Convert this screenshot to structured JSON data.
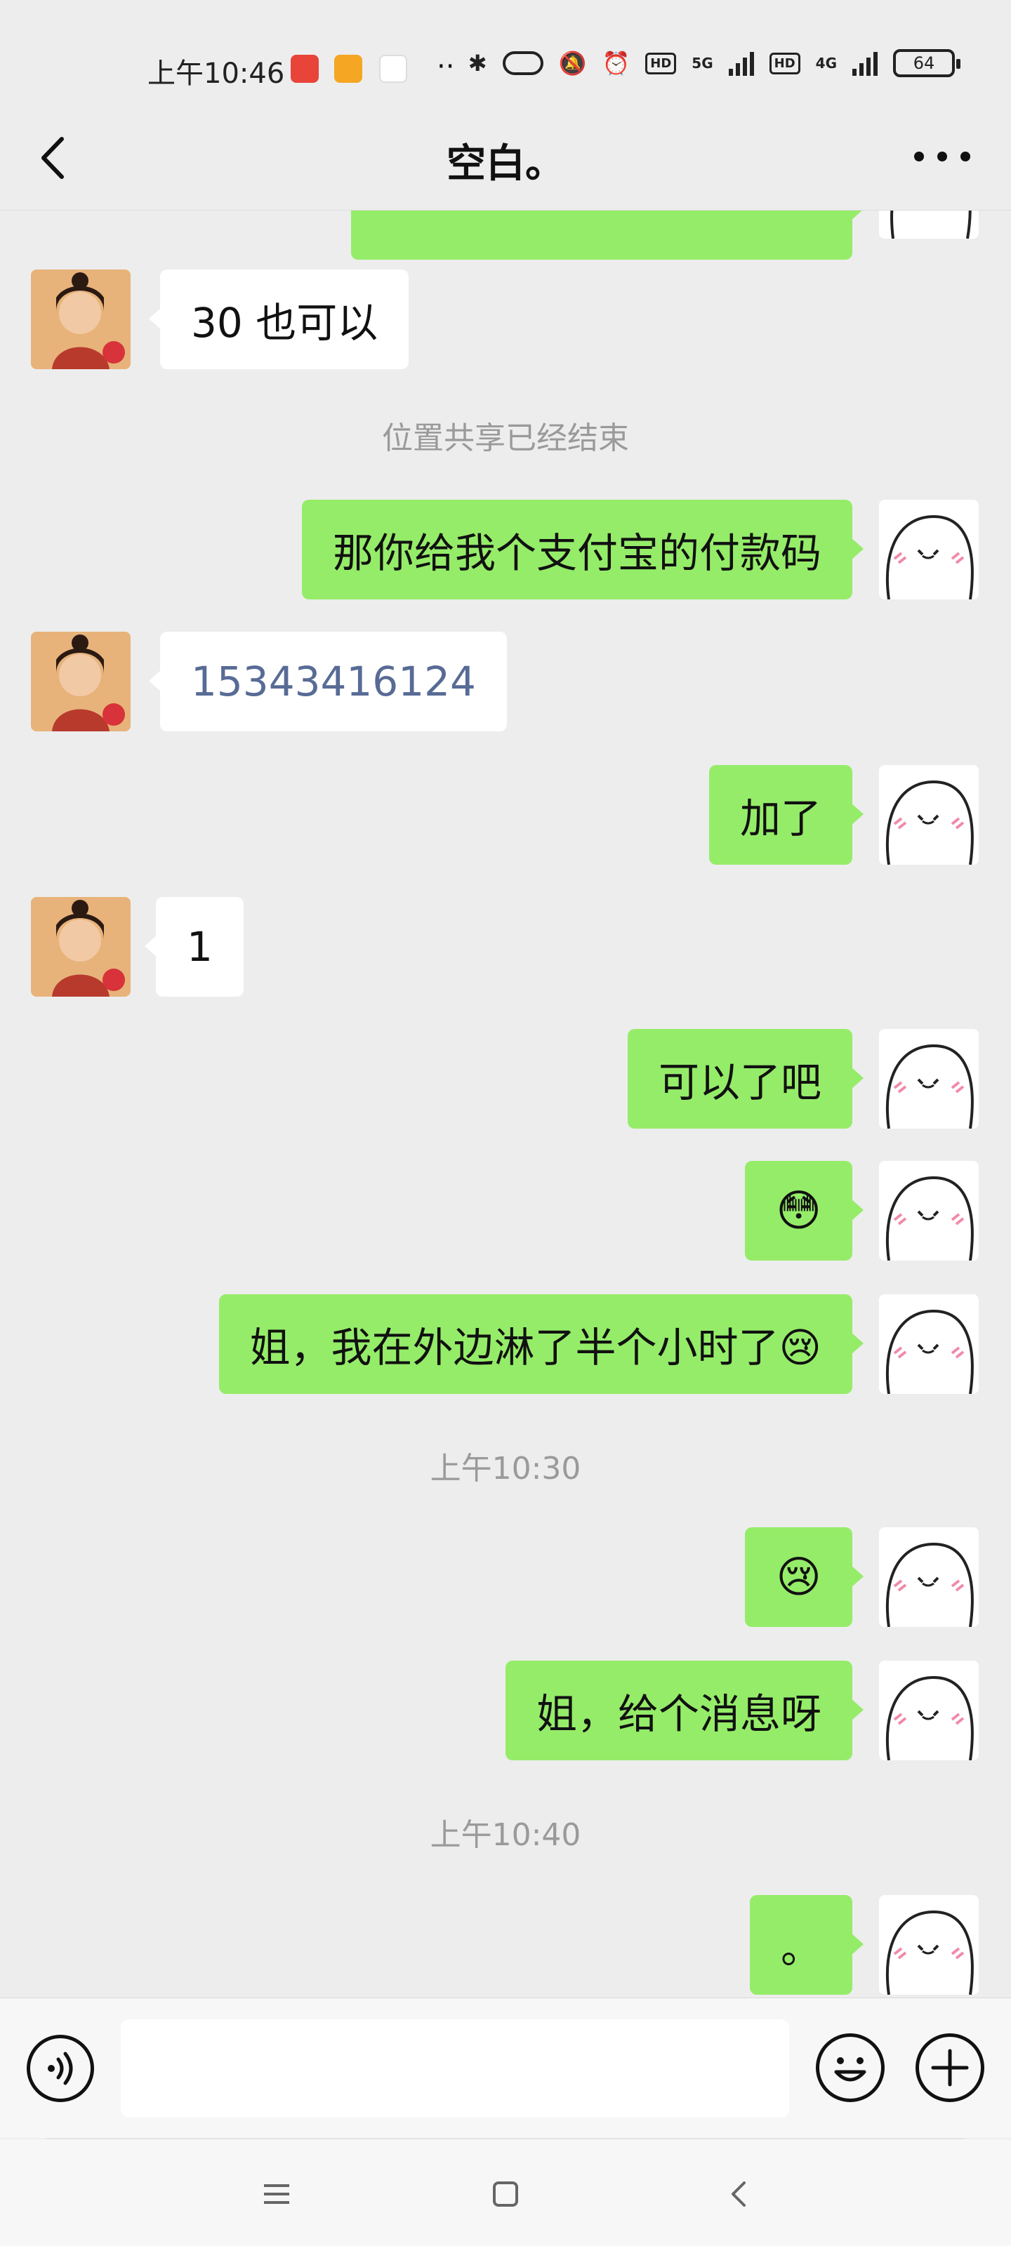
{
  "status_bar": {
    "time": "上午10:46",
    "network_1": "5G",
    "network_2": "4G",
    "hd_label": "HD",
    "battery": "64"
  },
  "header": {
    "title": "空白。"
  },
  "chat": {
    "messages": [
      {
        "side": "left",
        "type": "text",
        "text": "30 也可以"
      },
      {
        "side": "system",
        "type": "notice",
        "text": "位置共享已经结束"
      },
      {
        "side": "right",
        "type": "text",
        "text": "那你给我个支付宝的付款码"
      },
      {
        "side": "left",
        "type": "link",
        "text": "15343416124"
      },
      {
        "side": "right",
        "type": "text",
        "text": "加了"
      },
      {
        "side": "left",
        "type": "text",
        "text": "1"
      },
      {
        "side": "right",
        "type": "text",
        "text": "可以了吧"
      },
      {
        "side": "right",
        "type": "emoji",
        "text": "😳"
      },
      {
        "side": "right",
        "type": "text",
        "text": "姐，我在外边淋了半个小时了😢"
      },
      {
        "side": "system",
        "type": "timestamp",
        "text": "上午10:30"
      },
      {
        "side": "right",
        "type": "emoji",
        "text": "😢"
      },
      {
        "side": "right",
        "type": "text",
        "text": "姐，给个消息呀"
      },
      {
        "side": "system",
        "type": "timestamp",
        "text": "上午10:40"
      },
      {
        "side": "right",
        "type": "text",
        "text": "。"
      }
    ]
  },
  "input": {
    "value": "",
    "placeholder": ""
  },
  "icons": {
    "back": "chevron-left-icon",
    "more": "more-dots-icon",
    "voice": "voice-icon",
    "emoji": "smiley-icon",
    "plus": "plus-icon",
    "nav_menu": "menu-icon",
    "nav_home": "home-icon",
    "nav_back": "back-icon"
  },
  "colors": {
    "background": "#ededed",
    "sent_bubble": "#95ec69",
    "received_bubble": "#ffffff",
    "link": "#576b95",
    "system_text": "#9a9a9a"
  }
}
